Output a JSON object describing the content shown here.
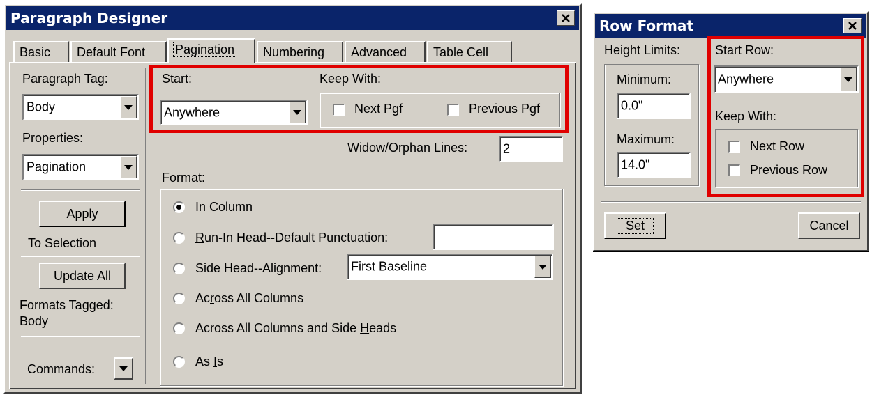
{
  "paragraph_designer": {
    "title": "Paragraph Designer",
    "tabs": [
      {
        "label": "Basic"
      },
      {
        "label": "Default Font"
      },
      {
        "label": "Pagination"
      },
      {
        "label": "Numbering"
      },
      {
        "label": "Advanced"
      },
      {
        "label": "Table Cell"
      }
    ],
    "active_tab": "Pagination",
    "sidebar": {
      "paragraph_tag_label": "Paragraph Tag:",
      "paragraph_tag_value": "Body",
      "properties_label": "Properties:",
      "properties_value": "Pagination",
      "apply_button": "Apply",
      "apply_caption": "To Selection",
      "update_all_button": "Update All",
      "formats_tagged_label": "Formats Tagged:",
      "formats_tagged_value": "Body",
      "commands_label": "Commands:"
    },
    "pagination": {
      "start_label": "Start:",
      "start_value": "Anywhere",
      "keep_with_label": "Keep With:",
      "next_pgf_label": "Next Pgf",
      "next_pgf_checked": false,
      "previous_pgf_label": "Previous Pgf",
      "previous_pgf_checked": false,
      "widow_orphan_label": "Widow/Orphan Lines:",
      "widow_orphan_value": "2",
      "format_label": "Format:",
      "format_options": [
        {
          "label": "In Column",
          "selected": true
        },
        {
          "label": "Run-In Head--Default Punctuation:",
          "selected": false
        },
        {
          "label": "Side Head--Alignment:",
          "selected": false
        },
        {
          "label": "Across All Columns",
          "selected": false
        },
        {
          "label": "Across All Columns and Side Heads",
          "selected": false
        },
        {
          "label": "As Is",
          "selected": false
        }
      ],
      "run_in_punctuation_value": "",
      "side_head_alignment_value": "First Baseline"
    }
  },
  "row_format": {
    "title": "Row Format",
    "height_limits_label": "Height Limits:",
    "minimum_label": "Minimum:",
    "minimum_value": "0.0\"",
    "maximum_label": "Maximum:",
    "maximum_value": "14.0\"",
    "start_row_label": "Start Row:",
    "start_row_value": "Anywhere",
    "keep_with_label": "Keep With:",
    "next_row_label": "Next Row",
    "next_row_checked": false,
    "previous_row_label": "Previous Row",
    "previous_row_checked": false,
    "set_button": "Set",
    "cancel_button": "Cancel"
  },
  "colors": {
    "titlebar": "#0a246a",
    "dialog_face": "#d4d0c8",
    "highlight_box": "#e00000"
  },
  "icons": [
    "close-icon",
    "dropdown-arrow-icon",
    "checkbox-icon",
    "radio-icon"
  ]
}
